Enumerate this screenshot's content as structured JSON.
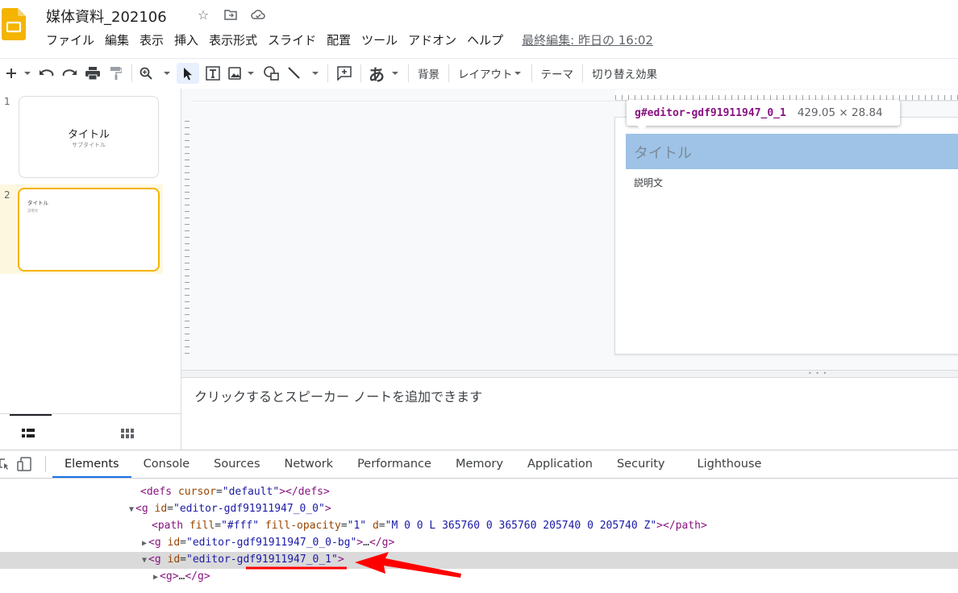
{
  "header": {
    "doc_title": "媒体資料_202106",
    "menu": [
      "ファイル",
      "編集",
      "表示",
      "挿入",
      "表示形式",
      "スライド",
      "配置",
      "ツール",
      "アドオン",
      "ヘルプ"
    ],
    "last_edit": "最終編集: 昨日の 16:02"
  },
  "toolbar": {
    "background_label": "背景",
    "layout_label": "レイアウト",
    "theme_label": "テーマ",
    "transition_label": "切り替え効果",
    "text_style_glyph": "あ"
  },
  "filmstrip": {
    "slides": [
      {
        "number": "1",
        "title": "タイトル",
        "subtitle": "サブタイトル"
      },
      {
        "number": "2",
        "title": "タイトル",
        "body": "説明文"
      }
    ]
  },
  "canvas": {
    "title_placeholder": "タイトル",
    "description": "説明文",
    "inspect_tooltip": {
      "selector": "g#editor-gdf91911947_0_1",
      "size": "429.05 × 28.84"
    }
  },
  "notes": {
    "placeholder": "クリックするとスピーカー ノートを追加できます"
  },
  "devtools": {
    "tabs": [
      "Elements",
      "Console",
      "Sources",
      "Network",
      "Performance",
      "Memory",
      "Application",
      "Security",
      "Lighthouse"
    ],
    "active_tab": "Elements",
    "lines": {
      "l1_tag": "defs",
      "l1_attr": "cursor",
      "l1_val": "\"default\"",
      "l2_tag": "g",
      "l2_attr": "id",
      "l2_val": "\"editor-gdf91911947_0_0\"",
      "l3_tag": "path",
      "l3_fill_attr": "fill",
      "l3_fill_val": "\"#fff\"",
      "l3_op_attr": "fill-opacity",
      "l3_op_val": "\"1\"",
      "l3_d_attr": "d",
      "l3_d_val": "\"M 0 0 L 365760 0 365760 205740 0 205740 Z\"",
      "l4_tag": "g",
      "l4_attr": "id",
      "l4_val": "\"editor-gdf91911947_0_0-bg\"",
      "l5_tag": "g",
      "l5_attr": "id",
      "l5_val": "\"editor-gdf91911947_0_1\"",
      "l6_tag": "g"
    }
  },
  "colors": {
    "accent_blue": "#1a73e8",
    "selection_yellow": "#f4b400",
    "annotation_red": "#ff0000",
    "title_box": "#9ec3e6"
  }
}
